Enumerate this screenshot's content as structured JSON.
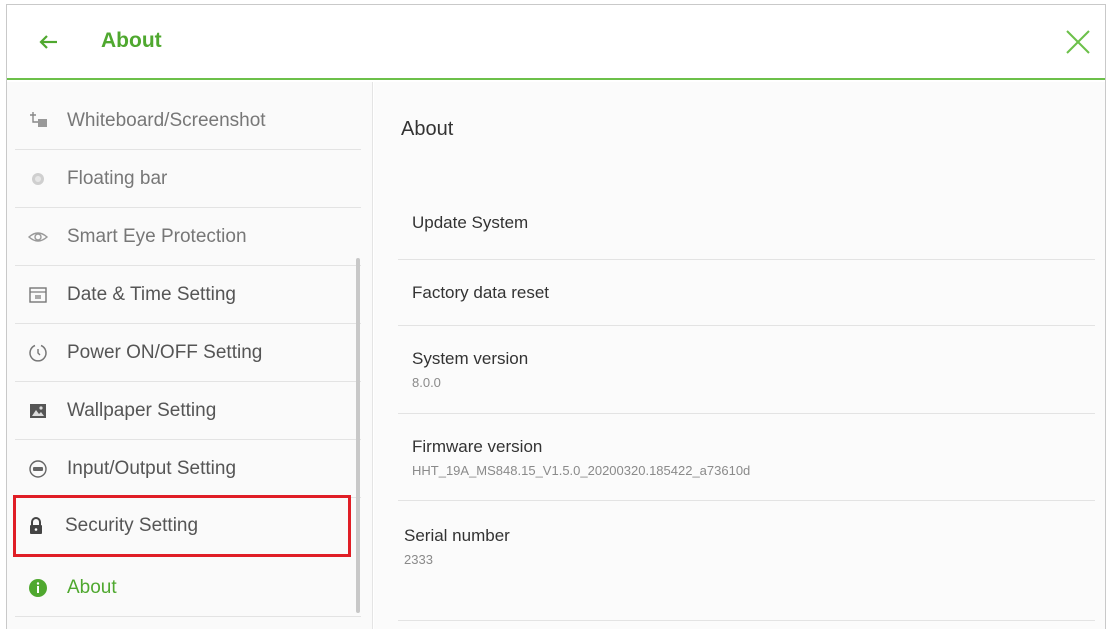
{
  "header": {
    "title": "About",
    "back_icon": "back-arrow-icon",
    "close_icon": "close-icon",
    "accent": "#4fa82f"
  },
  "sidebar": {
    "items": [
      {
        "label": "Whiteboard/Screenshot",
        "icon": "whiteboard-screenshot-icon"
      },
      {
        "label": "Floating bar",
        "icon": "floating-bar-icon"
      },
      {
        "label": "Smart Eye Protection",
        "icon": "eye-icon"
      },
      {
        "label": "Date & Time Setting",
        "icon": "calendar-icon"
      },
      {
        "label": "Power ON/OFF Setting",
        "icon": "power-timer-icon"
      },
      {
        "label": "Wallpaper Setting",
        "icon": "wallpaper-icon"
      },
      {
        "label": "Input/Output Setting",
        "icon": "input-output-icon"
      },
      {
        "label": "Security Setting",
        "icon": "lock-icon"
      },
      {
        "label": "About",
        "icon": "info-icon"
      }
    ]
  },
  "content": {
    "title": "About",
    "rows": [
      {
        "label": "Update System"
      },
      {
        "label": "Factory data reset"
      },
      {
        "label": "System version",
        "value": "8.0.0"
      },
      {
        "label": "Firmware version",
        "value": "HHT_19A_MS848.15_V1.5.0_20200320.185422_a73610d"
      },
      {
        "label": "Serial number",
        "value": "2333"
      }
    ]
  }
}
